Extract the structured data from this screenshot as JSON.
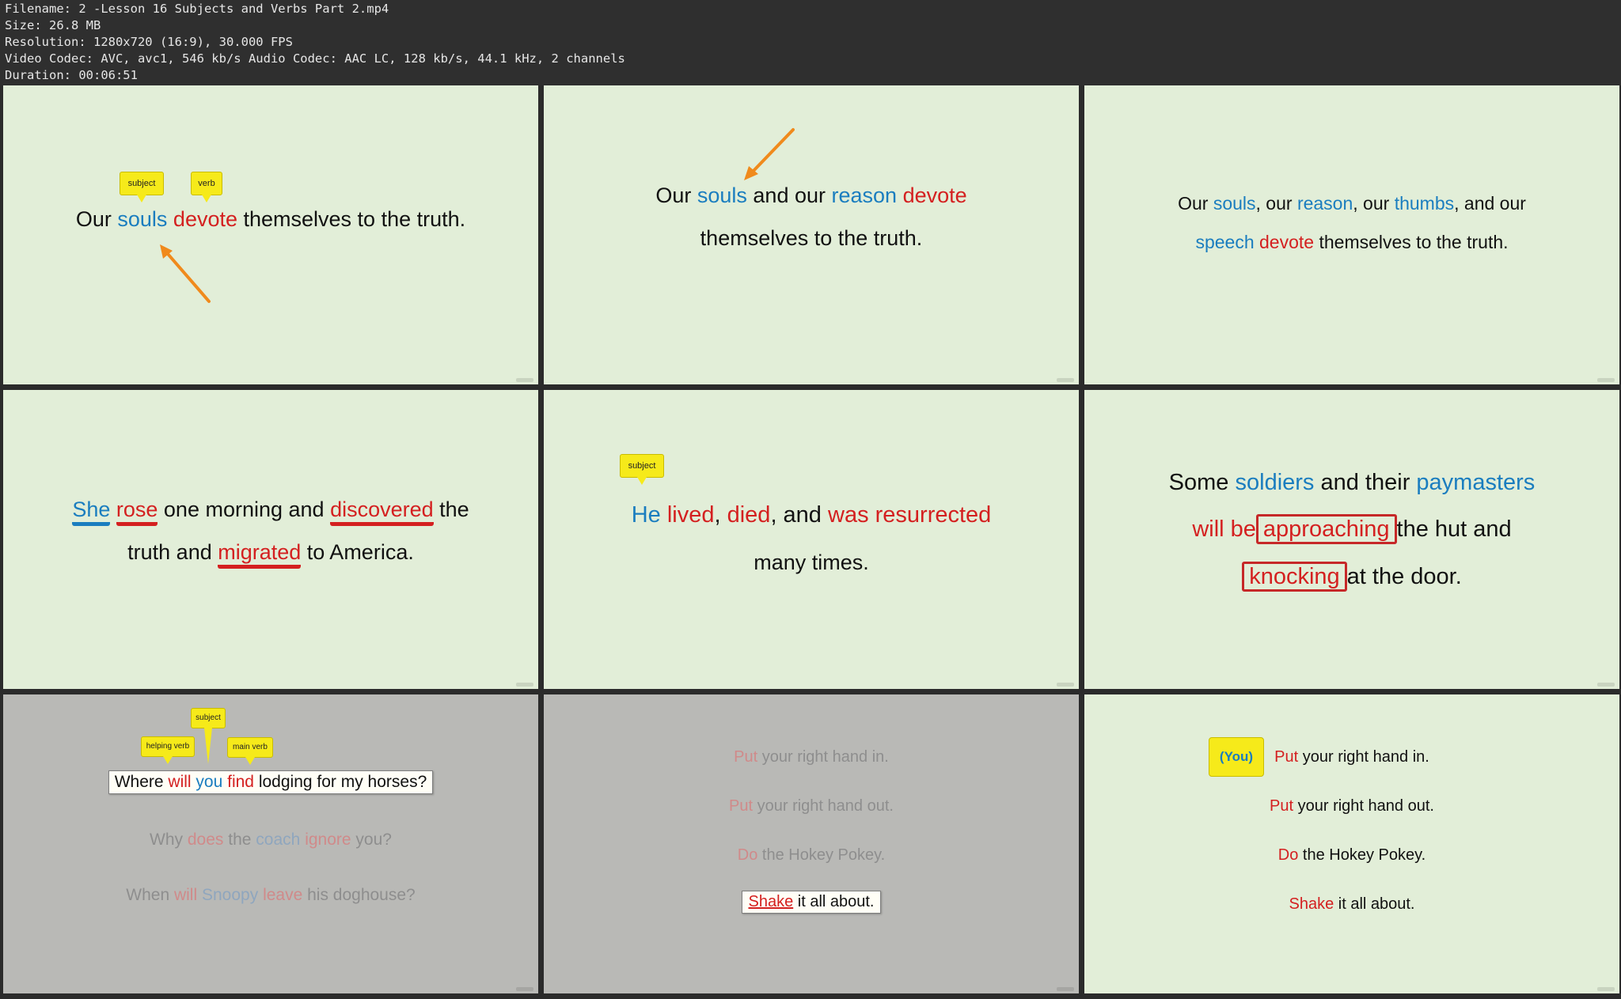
{
  "header": {
    "filename": "Filename: 2 -Lesson 16 Subjects and Verbs Part 2.mp4",
    "size": "Size: 26.8 MB",
    "resolution": "Resolution: 1280x720 (16:9), 30.000 FPS",
    "codec": "Video Codec: AVC, avc1, 546 kb/s Audio Codec: AAC LC, 128 kb/s, 44.1 kHz, 2 channels",
    "duration": "Duration: 00:06:51"
  },
  "colors": {
    "background": "#e2eed8",
    "dimmed_background": "#b9b9b6",
    "subject_blue": "#1a7dbf",
    "verb_red": "#d42020",
    "callout_yellow": "#f6ea1a",
    "arrow_orange": "#f08a1c"
  },
  "icons": [
    "arrow-icon",
    "callout-icon"
  ],
  "thumbs": {
    "t1": {
      "callouts": {
        "subject": "subject",
        "verb": "verb"
      },
      "w": [
        "Our ",
        "souls",
        " ",
        "devote",
        " themselves to the truth."
      ]
    },
    "t2": {
      "line1": [
        "Our ",
        "souls",
        " and our ",
        "reason",
        " ",
        "devote"
      ],
      "line2": "themselves to the truth."
    },
    "t3": {
      "line1": [
        "Our ",
        "souls",
        ", our ",
        "reason",
        ", our ",
        "thumbs",
        ", and our"
      ],
      "line2": [
        "speech",
        " ",
        "devote",
        " themselves to the truth."
      ]
    },
    "t4": {
      "line1": [
        "She",
        " ",
        "rose",
        " one morning and ",
        "discovered",
        " the"
      ],
      "line2": [
        "truth and ",
        "migrated",
        " to America."
      ]
    },
    "t5": {
      "callout": "subject",
      "line1": [
        "He",
        " ",
        "lived",
        ", ",
        "died",
        ", and ",
        "was resurrected"
      ],
      "line2": "many times."
    },
    "t6": {
      "line1": [
        "Some ",
        "soldiers",
        " and their ",
        "paymasters"
      ],
      "line2": [
        "will be",
        "approaching",
        "the hut and"
      ],
      "line3": [
        "knocking",
        "at the door."
      ]
    },
    "t7": {
      "callouts": {
        "subject": "subject",
        "helping": "helping verb",
        "main": "main verb"
      },
      "q1": [
        "Where ",
        "will",
        " ",
        "you",
        " ",
        "find",
        " lodging for my horses?"
      ],
      "q2": [
        "Why ",
        "does",
        " the ",
        "coach",
        " ",
        "ignore",
        " you?"
      ],
      "q3": [
        "When ",
        "will",
        " ",
        "Snoopy",
        " ",
        "leave",
        " his doghouse?"
      ]
    },
    "t8": {
      "l1": [
        "Put",
        " your right hand in."
      ],
      "l2": [
        "Put",
        " your right hand out."
      ],
      "l3": [
        "Do",
        " the Hokey Pokey."
      ],
      "l4": [
        "Shake",
        " it all about."
      ]
    },
    "t9": {
      "badge": "(You)",
      "l1": [
        "Put",
        " your right hand in."
      ],
      "l2": [
        "Put",
        " your right hand out."
      ],
      "l3": [
        "Do",
        " the Hokey Pokey."
      ],
      "l4": [
        "Shake",
        " it all about."
      ]
    }
  }
}
